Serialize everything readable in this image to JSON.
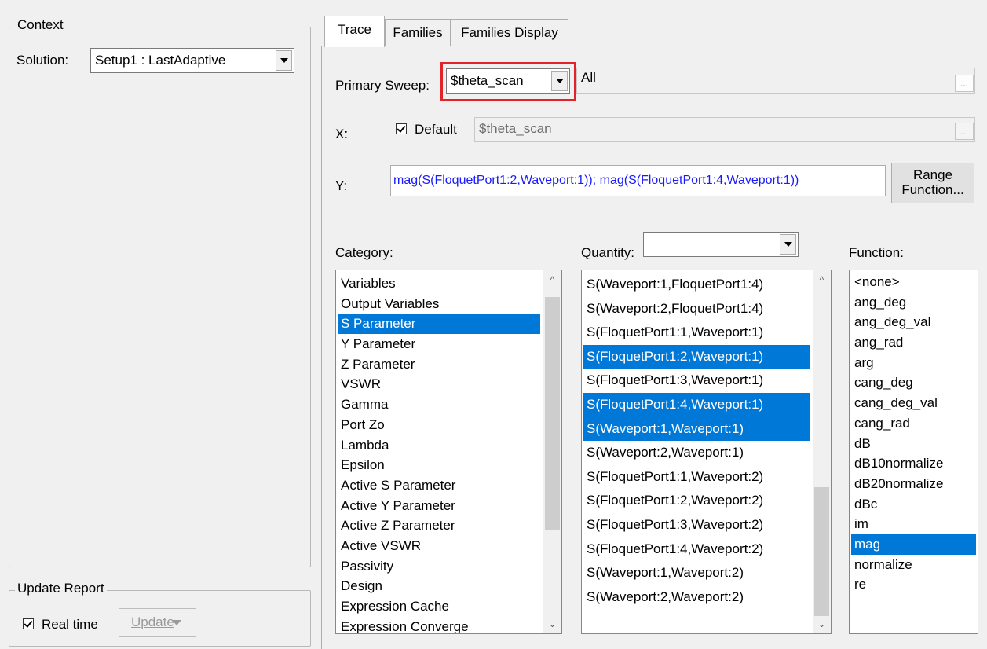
{
  "context": {
    "title": "Context",
    "solution_label": "Solution:",
    "solution_value": "Setup1 : LastAdaptive"
  },
  "update_report": {
    "title": "Update Report",
    "realtime_label": "Real time",
    "realtime_checked": true,
    "update_button": "Update"
  },
  "tabs": [
    {
      "label": "Trace",
      "active": true
    },
    {
      "label": "Families",
      "active": false
    },
    {
      "label": "Families Display",
      "active": false
    }
  ],
  "trace": {
    "primary_sweep_label": "Primary Sweep:",
    "primary_sweep_value": "$theta_scan",
    "primary_sweep_range": "All",
    "dots": "...",
    "x_label": "X:",
    "x_default_label": "Default",
    "x_default_checked": true,
    "x_value": "$theta_scan",
    "y_label": "Y:",
    "y_value": "mag(S(FloquetPort1:2,Waveport:1)); mag(S(FloquetPort1:4,Waveport:1))",
    "range_function_line1": "Range",
    "range_function_line2": "Function..."
  },
  "category": {
    "label": "Category:",
    "items": [
      "Variables",
      "Output Variables",
      "S Parameter",
      "Y Parameter",
      "Z Parameter",
      "VSWR",
      "Gamma",
      "Port Zo",
      "Lambda",
      "Epsilon",
      "Active S Parameter",
      "Active Y Parameter",
      "Active Z Parameter",
      "Active VSWR",
      "Passivity",
      "Design",
      "Expression Cache",
      "Expression Converge"
    ],
    "selected": [
      "S Parameter"
    ]
  },
  "quantity": {
    "label": "Quantity:",
    "filter_value": "",
    "items": [
      "S(Waveport:1,FloquetPort1:4)",
      "S(Waveport:2,FloquetPort1:4)",
      "S(FloquetPort1:1,Waveport:1)",
      "S(FloquetPort1:2,Waveport:1)",
      "S(FloquetPort1:3,Waveport:1)",
      "S(FloquetPort1:4,Waveport:1)",
      "S(Waveport:1,Waveport:1)",
      "S(Waveport:2,Waveport:1)",
      "S(FloquetPort1:1,Waveport:2)",
      "S(FloquetPort1:2,Waveport:2)",
      "S(FloquetPort1:3,Waveport:2)",
      "S(FloquetPort1:4,Waveport:2)",
      "S(Waveport:1,Waveport:2)",
      "S(Waveport:2,Waveport:2)"
    ],
    "selected": [
      "S(FloquetPort1:2,Waveport:1)",
      "S(FloquetPort1:4,Waveport:1)",
      "S(Waveport:1,Waveport:1)"
    ]
  },
  "function": {
    "label": "Function:",
    "items": [
      "<none>",
      "ang_deg",
      "ang_deg_val",
      "ang_rad",
      "arg",
      "cang_deg",
      "cang_deg_val",
      "cang_rad",
      "dB",
      "dB10normalize",
      "dB20normalize",
      "dBc",
      "im",
      "mag",
      "normalize",
      "re"
    ],
    "selected": [
      "mag"
    ]
  },
  "colors": {
    "selection": "#0078d7",
    "highlight_box": "#e0242a",
    "y_expression_text": "#1a1aff"
  }
}
